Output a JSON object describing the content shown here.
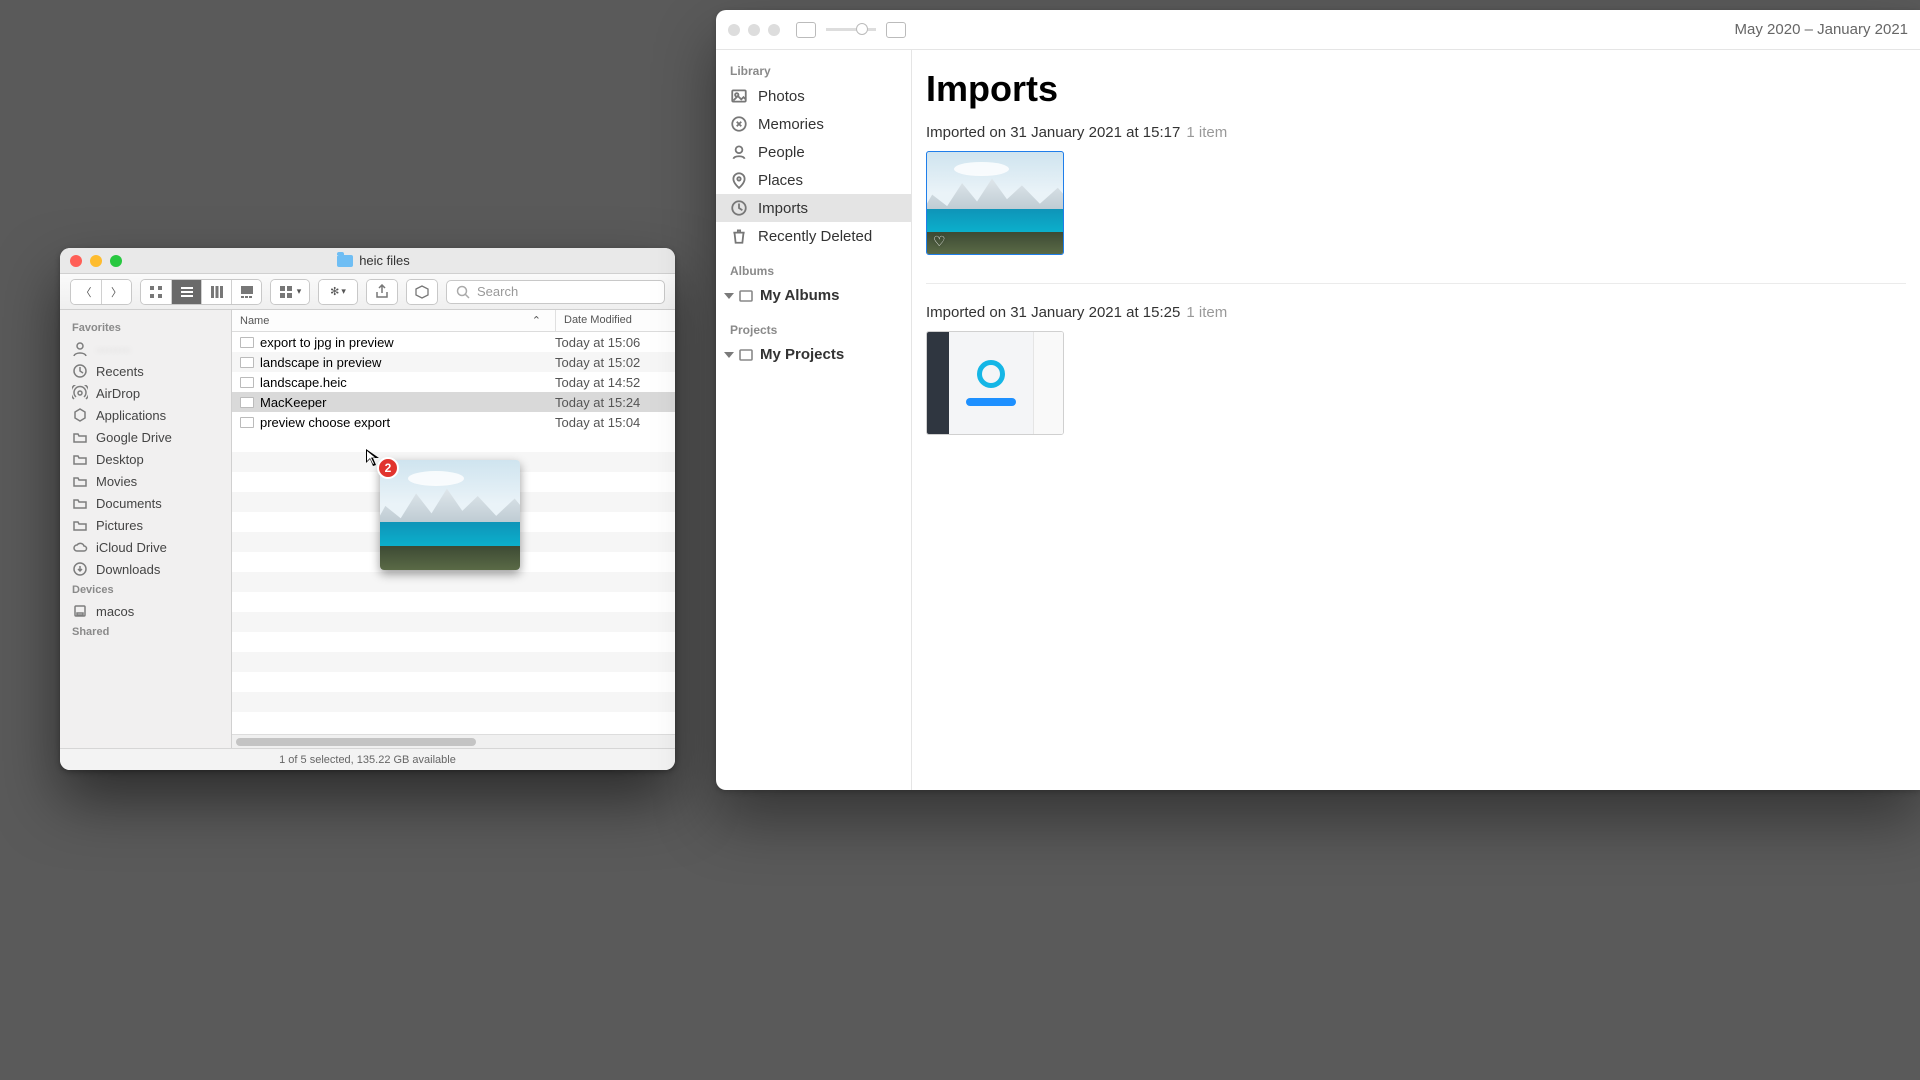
{
  "finder": {
    "window_title": "heic files",
    "toolbar": {
      "search_placeholder": "Search"
    },
    "sidebar": {
      "sections": [
        {
          "header": "Favorites",
          "items": [
            {
              "label": "········",
              "icon": "user",
              "blur": true
            },
            {
              "label": "Recents",
              "icon": "clock"
            },
            {
              "label": "AirDrop",
              "icon": "airdrop"
            },
            {
              "label": "Applications",
              "icon": "apps"
            },
            {
              "label": "Google Drive",
              "icon": "folder"
            },
            {
              "label": "Desktop",
              "icon": "folder"
            },
            {
              "label": "Movies",
              "icon": "folder"
            },
            {
              "label": "Documents",
              "icon": "folder"
            },
            {
              "label": "Pictures",
              "icon": "folder"
            },
            {
              "label": "iCloud Drive",
              "icon": "cloud"
            },
            {
              "label": "Downloads",
              "icon": "download"
            }
          ]
        },
        {
          "header": "Devices",
          "items": [
            {
              "label": "macos",
              "icon": "disk"
            }
          ]
        },
        {
          "header": "Shared",
          "items": []
        }
      ]
    },
    "columns": {
      "name": "Name",
      "date": "Date Modified"
    },
    "files": [
      {
        "name": "export to jpg in preview",
        "date": "Today at 15:06"
      },
      {
        "name": "landscape in preview",
        "date": "Today at 15:02"
      },
      {
        "name": "landscape.heic",
        "date": "Today at 14:52"
      },
      {
        "name": "MacKeeper",
        "date": "Today at 15:24",
        "selected": true
      },
      {
        "name": "preview choose export",
        "date": "Today at 15:04"
      }
    ],
    "status": "1 of 5 selected, 135.22 GB available",
    "drag_badge": "2"
  },
  "photos": {
    "toolbar_date": "May 2020 – January 2021",
    "sidebar": {
      "library_header": "Library",
      "library_items": [
        {
          "label": "Photos",
          "icon": "photos"
        },
        {
          "label": "Memories",
          "icon": "memories"
        },
        {
          "label": "People",
          "icon": "people"
        },
        {
          "label": "Places",
          "icon": "places"
        },
        {
          "label": "Imports",
          "icon": "imports",
          "selected": true
        },
        {
          "label": "Recently Deleted",
          "icon": "trash"
        }
      ],
      "albums_header": "Albums",
      "my_albums": "My Albums",
      "projects_header": "Projects",
      "my_projects": "My Projects"
    },
    "main": {
      "title": "Imports",
      "imports": [
        {
          "line": "Imported on 31 January 2021 at 15:17",
          "count": "1 item",
          "thumb": "scene",
          "selected": true
        },
        {
          "line": "Imported on 31 January 2021 at 15:25",
          "count": "1 item",
          "thumb": "appshot"
        }
      ]
    }
  }
}
